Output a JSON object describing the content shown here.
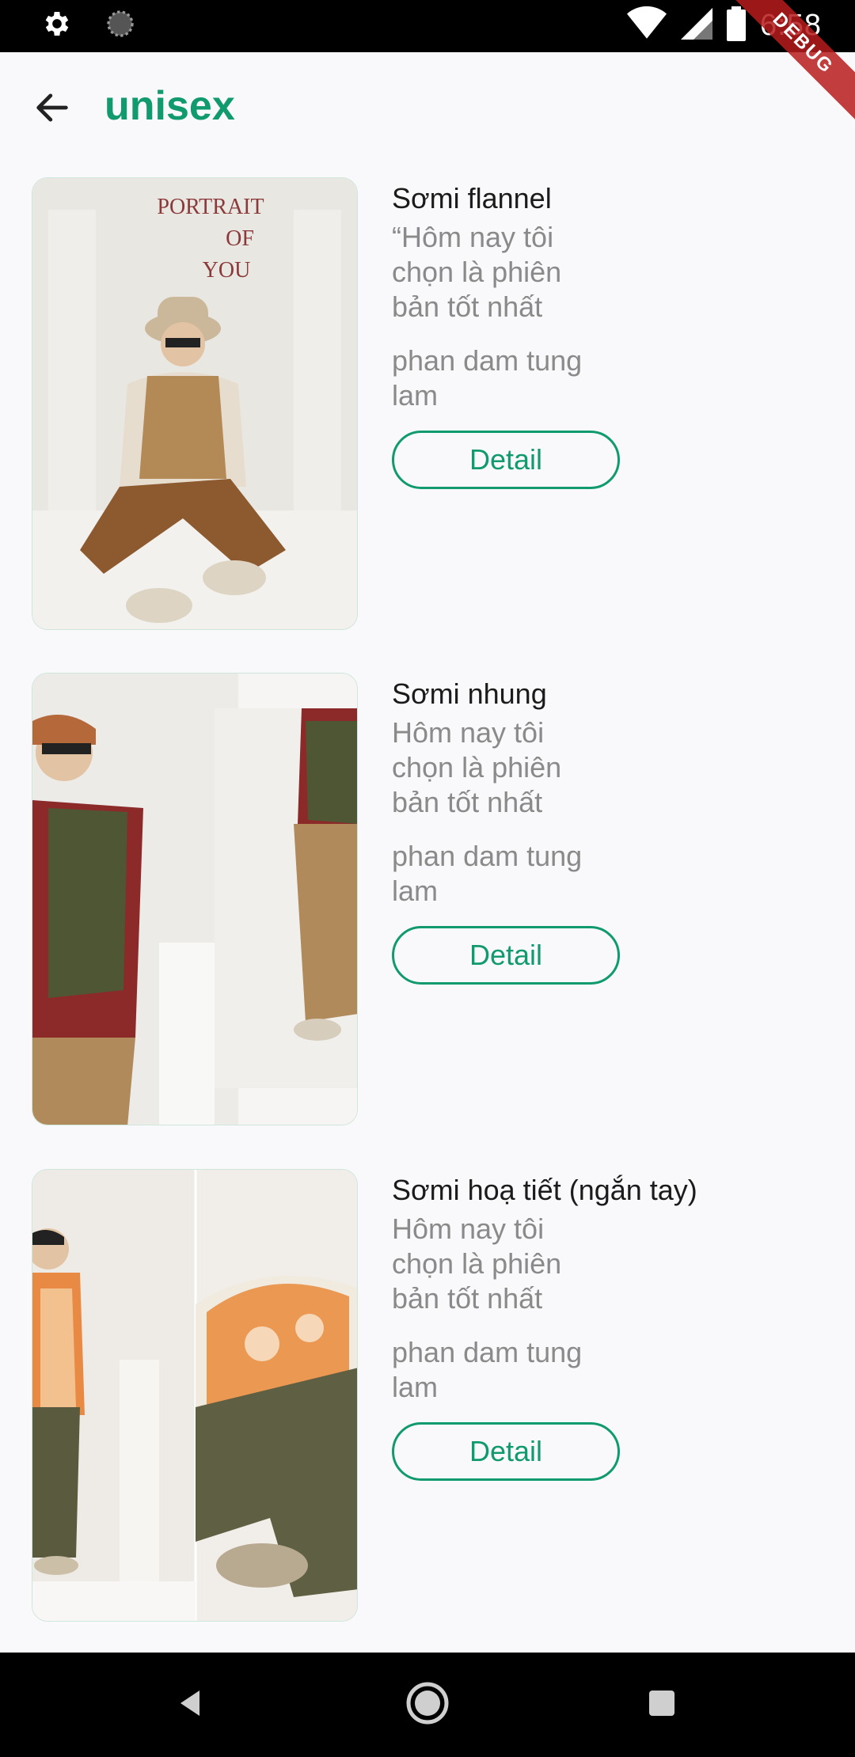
{
  "status_bar": {
    "time": "6:58",
    "icons": [
      "settings-icon",
      "sync-icon",
      "wifi-icon",
      "signal-icon",
      "battery-icon"
    ]
  },
  "debug_banner": "DEBUG",
  "app_bar": {
    "title": "unisex",
    "back_icon": "arrow-back-icon"
  },
  "products": [
    {
      "name": "Sơmi flannel",
      "description": "“Hôm nay tôi chọn là phiên bản tốt nhất",
      "author": "phan dam tung lam",
      "button_label": "Detail",
      "image_text": [
        "PORTRAIT",
        "OF",
        "YOU"
      ]
    },
    {
      "name": "Sơmi nhung",
      "description": "Hôm nay tôi chọn là phiên bản tốt nhất",
      "author": "phan dam tung lam",
      "button_label": "Detail"
    },
    {
      "name": "Sơmi hoạ tiết (ngắn tay)",
      "description": "Hôm nay tôi chọn là phiên bản tốt nhất",
      "author": "phan dam tung lam",
      "button_label": "Detail"
    }
  ],
  "colors": {
    "accent": "#119a6e",
    "muted_text": "#8a8a8a",
    "background": "#f9f9fb"
  }
}
